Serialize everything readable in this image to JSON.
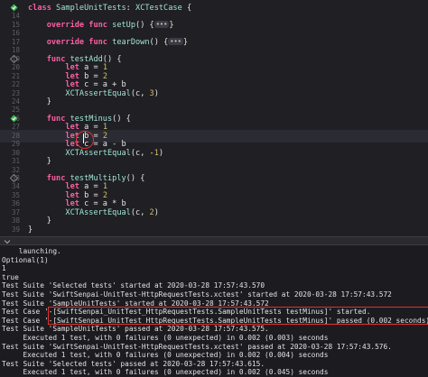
{
  "editor": {
    "lines": [
      {
        "num": "",
        "marker": "run-diamond-green",
        "parts": [
          [
            "kw",
            "class "
          ],
          [
            "ty",
            "SampleUnitTests"
          ],
          [
            "plain",
            ": "
          ],
          [
            "ty",
            "XCTestCase"
          ],
          [
            "plain",
            " {"
          ]
        ]
      },
      {
        "num": "14",
        "marker": "",
        "parts": []
      },
      {
        "num": "15",
        "marker": "",
        "parts": [
          [
            "plain",
            "    "
          ],
          [
            "kw",
            "override func "
          ],
          [
            "fn",
            "setUp"
          ],
          [
            "plain",
            "() {"
          ],
          [
            "pill",
            "•••"
          ],
          [
            "plain",
            "}"
          ]
        ]
      },
      {
        "num": "16",
        "marker": "",
        "parts": []
      },
      {
        "num": "17",
        "marker": "",
        "parts": [
          [
            "plain",
            "    "
          ],
          [
            "kw",
            "override func "
          ],
          [
            "fn",
            "tearDown"
          ],
          [
            "plain",
            "() {"
          ],
          [
            "pill",
            "•••"
          ],
          [
            "plain",
            "}"
          ]
        ]
      },
      {
        "num": "18",
        "marker": "",
        "parts": []
      },
      {
        "num": "19",
        "marker": "run-diamond",
        "parts": [
          [
            "plain",
            "    "
          ],
          [
            "kw",
            "func "
          ],
          [
            "fn",
            "testAdd"
          ],
          [
            "plain",
            "() {"
          ]
        ]
      },
      {
        "num": "20",
        "marker": "",
        "parts": [
          [
            "plain",
            "        "
          ],
          [
            "kw",
            "let "
          ],
          [
            "plain",
            "a = "
          ],
          [
            "num",
            "1"
          ]
        ]
      },
      {
        "num": "21",
        "marker": "",
        "parts": [
          [
            "plain",
            "        "
          ],
          [
            "kw",
            "let "
          ],
          [
            "plain",
            "b = "
          ],
          [
            "num",
            "2"
          ]
        ]
      },
      {
        "num": "22",
        "marker": "",
        "parts": [
          [
            "plain",
            "        "
          ],
          [
            "kw",
            "let "
          ],
          [
            "plain",
            "c = a + b"
          ]
        ]
      },
      {
        "num": "23",
        "marker": "",
        "parts": [
          [
            "plain",
            "        "
          ],
          [
            "fn",
            "XCTAssertEqual"
          ],
          [
            "plain",
            "(c, "
          ],
          [
            "num",
            "3"
          ],
          [
            "plain",
            ")"
          ]
        ]
      },
      {
        "num": "24",
        "marker": "",
        "parts": [
          [
            "plain",
            "    }"
          ]
        ]
      },
      {
        "num": "25",
        "marker": "",
        "parts": []
      },
      {
        "num": "26",
        "marker": "passed-diamond-green",
        "parts": [
          [
            "plain",
            "    "
          ],
          [
            "kw",
            "func "
          ],
          [
            "fn",
            "testMinus"
          ],
          [
            "plain",
            "() {"
          ]
        ]
      },
      {
        "num": "27",
        "marker": "",
        "parts": [
          [
            "plain",
            "        "
          ],
          [
            "kw",
            "let "
          ],
          [
            "plain",
            "a = "
          ],
          [
            "num",
            "1"
          ]
        ]
      },
      {
        "num": "28",
        "marker": "",
        "parts": [
          [
            "plain",
            "        "
          ],
          [
            "kw",
            "let "
          ],
          [
            "plain",
            "b = "
          ],
          [
            "num",
            "2"
          ]
        ],
        "current": true
      },
      {
        "num": "29",
        "marker": "",
        "parts": [
          [
            "plain",
            "        "
          ],
          [
            "kw",
            "let "
          ],
          [
            "plain",
            "c = a - b"
          ]
        ]
      },
      {
        "num": "30",
        "marker": "",
        "parts": [
          [
            "plain",
            "        "
          ],
          [
            "fn",
            "XCTAssertEqual"
          ],
          [
            "plain",
            "(c, -"
          ],
          [
            "num",
            "1"
          ],
          [
            "plain",
            ")"
          ]
        ]
      },
      {
        "num": "31",
        "marker": "",
        "parts": [
          [
            "plain",
            "    }"
          ]
        ]
      },
      {
        "num": "32",
        "marker": "",
        "parts": []
      },
      {
        "num": "33",
        "marker": "run-diamond",
        "parts": [
          [
            "plain",
            "    "
          ],
          [
            "kw",
            "func "
          ],
          [
            "fn",
            "testMultiply"
          ],
          [
            "plain",
            "() {"
          ]
        ]
      },
      {
        "num": "34",
        "marker": "",
        "parts": [
          [
            "plain",
            "        "
          ],
          [
            "kw",
            "let "
          ],
          [
            "plain",
            "a = "
          ],
          [
            "num",
            "1"
          ]
        ]
      },
      {
        "num": "35",
        "marker": "",
        "parts": [
          [
            "plain",
            "        "
          ],
          [
            "kw",
            "let "
          ],
          [
            "plain",
            "b = "
          ],
          [
            "num",
            "2"
          ]
        ]
      },
      {
        "num": "36",
        "marker": "",
        "parts": [
          [
            "plain",
            "        "
          ],
          [
            "kw",
            "let "
          ],
          [
            "plain",
            "c = a * b"
          ]
        ]
      },
      {
        "num": "37",
        "marker": "",
        "parts": [
          [
            "plain",
            "        "
          ],
          [
            "fn",
            "XCTAssertEqual"
          ],
          [
            "plain",
            "(c, "
          ],
          [
            "num",
            "2"
          ],
          [
            "plain",
            ")"
          ]
        ]
      },
      {
        "num": "38",
        "marker": "",
        "parts": [
          [
            "plain",
            "    }"
          ]
        ]
      },
      {
        "num": "39",
        "marker": "",
        "parts": [
          [
            "plain",
            "}"
          ]
        ]
      }
    ]
  },
  "divider": {
    "icon": "chevron-down-icon"
  },
  "console": {
    "lines": [
      "    launching.",
      "Optional(1)",
      "1",
      "true",
      "Test Suite 'Selected tests' started at 2020-03-28 17:57:43.570",
      "Test Suite 'SwiftSenpai-UnitTest-HttpRequestTests.xctest' started at 2020-03-28 17:57:43.572",
      "Test Suite 'SampleUnitTests' started at 2020-03-28 17:57:43.572",
      "Test Case '-[SwiftSenpai_UnitTest_HttpRequestTests.SampleUnitTests testMinus]' started.",
      "Test Case '-[SwiftSenpai_UnitTest_HttpRequestTests.SampleUnitTests testMinus]' passed (0.002 seconds).",
      "Test Suite 'SampleUnitTests' passed at 2020-03-28 17:57:43.575.",
      "     Executed 1 test, with 0 failures (0 unexpected) in 0.002 (0.003) seconds",
      "Test Suite 'SwiftSenpai-UnitTest-HttpRequestTests.xctest' passed at 2020-03-28 17:57:43.576.",
      "     Executed 1 test, with 0 failures (0 unexpected) in 0.002 (0.004) seconds",
      "Test Suite 'Selected tests' passed at 2020-03-28 17:57:43.615.",
      "     Executed 1 test, with 0 failures (0 unexpected) in 0.002 (0.045) seconds"
    ]
  },
  "colors": {
    "accent_red": "#e0322f",
    "pass_green": "#3fb950"
  }
}
